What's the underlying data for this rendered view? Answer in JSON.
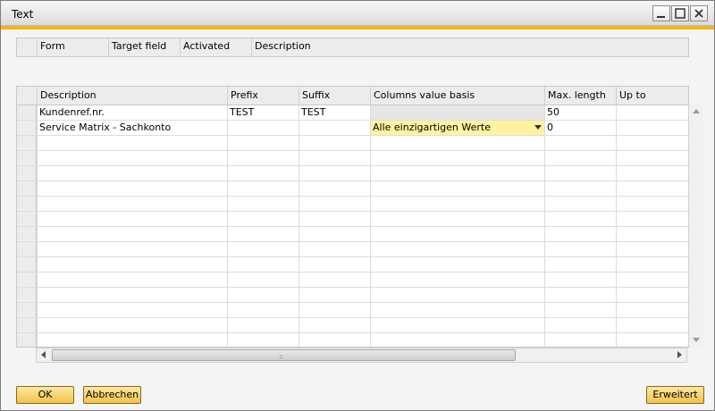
{
  "window": {
    "title": "Text"
  },
  "top_grid": {
    "columns": [
      "Form",
      "Target field",
      "Activated",
      "Description"
    ]
  },
  "grid": {
    "columns": [
      "Description",
      "Prefix",
      "Suffix",
      "Columns value basis",
      "Max. length",
      "Up to"
    ],
    "rows": [
      {
        "description": "Kundenref.nr.",
        "prefix": "TEST",
        "suffix": "TEST",
        "basis": "",
        "max_length": "50",
        "up_to": ""
      },
      {
        "description": "Service Matrix - Sachkonto",
        "prefix": "",
        "suffix": "",
        "basis": "Alle einzigartigen Werte",
        "max_length": "0",
        "up_to": ""
      }
    ]
  },
  "buttons": {
    "ok": "OK",
    "cancel": "Abbrechen",
    "extended": "Erweitert"
  },
  "colors": {
    "accent": "#f5b41d",
    "button": "#f3c24a",
    "dropdown_highlight": "#fff3a0"
  }
}
